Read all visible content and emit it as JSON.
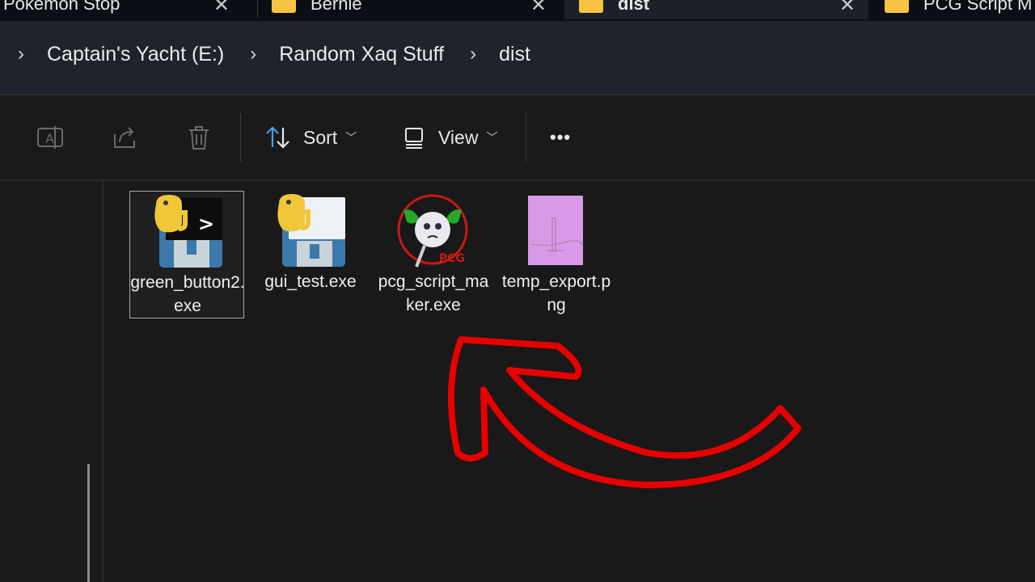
{
  "tabs": [
    {
      "label": "Pokemon Stop",
      "active": false
    },
    {
      "label": "Bernie",
      "active": false
    },
    {
      "label": "dist",
      "active": true
    },
    {
      "label": "PCG Script M",
      "active": false
    }
  ],
  "breadcrumb": {
    "items": [
      "Captain's Yacht (E:)",
      "Random Xaq Stuff",
      "dist"
    ]
  },
  "toolbar": {
    "sort_label": "Sort",
    "view_label": "View",
    "more_label": "•••"
  },
  "files": [
    {
      "name": "green_button2.exe",
      "icon": "python-exe-console-icon",
      "selected": true
    },
    {
      "name": "gui_test.exe",
      "icon": "python-exe-gui-icon",
      "selected": false
    },
    {
      "name": "pcg_script_maker.exe",
      "icon": "pcg-app-icon",
      "selected": false
    },
    {
      "name": "temp_export.png",
      "icon": "png-thumbnail",
      "selected": false
    }
  ],
  "annotation": {
    "arrow_color": "#e60000"
  },
  "colors": {
    "folder": "#f6c343",
    "accent": "#4a9fe0",
    "background": "#191919"
  }
}
